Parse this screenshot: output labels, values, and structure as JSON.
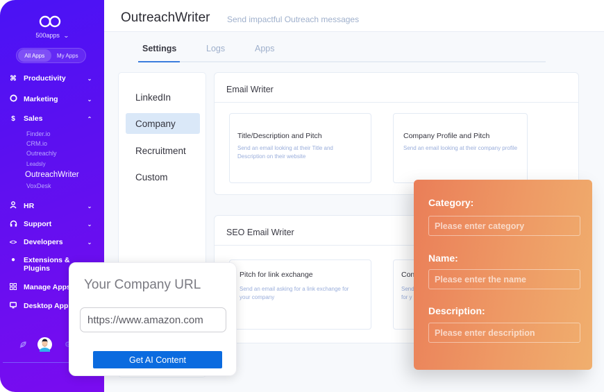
{
  "sidebar": {
    "brand": "500apps",
    "toggle": [
      {
        "label": "All Apps",
        "active": true
      },
      {
        "label": "My Apps",
        "active": false
      }
    ],
    "nav": [
      {
        "label": "Productivity",
        "icon": "command-icon",
        "expanded": false
      },
      {
        "label": "Marketing",
        "icon": "lifebuoy-icon",
        "expanded": false
      },
      {
        "label": "Sales",
        "icon": "dollar-icon",
        "expanded": true
      },
      {
        "label": "HR",
        "icon": "user-icon",
        "expanded": false
      },
      {
        "label": "Support",
        "icon": "headphones-icon",
        "expanded": false
      },
      {
        "label": "Developers",
        "icon": "code-icon",
        "expanded": false
      },
      {
        "label": "Extensions & Plugins",
        "icon": "puzzle-icon"
      },
      {
        "label": "Manage Apps",
        "icon": "grid-icon"
      },
      {
        "label": "Desktop Apps",
        "icon": "monitor-icon"
      }
    ],
    "sales_apps": [
      "Finder.io",
      "CRM.io",
      "Outreachly",
      "Leadsly",
      "OutreachWriter",
      "VoxDesk"
    ],
    "active_app": "OutreachWriter",
    "footer_icons": [
      "feather-icon",
      "avatar",
      "settings-icon"
    ]
  },
  "header": {
    "title": "OutreachWriter",
    "subtitle": "Send impactful Outreach messages"
  },
  "tabs": [
    {
      "label": "Settings",
      "active": true
    },
    {
      "label": "Logs",
      "active": false
    },
    {
      "label": "Apps",
      "active": false
    }
  ],
  "categories": [
    {
      "label": "LinkedIn",
      "active": false
    },
    {
      "label": "Company",
      "active": true
    },
    {
      "label": "Recruitment",
      "active": false
    },
    {
      "label": "Custom",
      "active": false
    }
  ],
  "sections": [
    {
      "title": "Email Writer",
      "cards": [
        {
          "title": "Title/Description and Pitch",
          "desc": "Send an email looking at their Title and Description on their website"
        },
        {
          "title": "Company Profile and Pitch",
          "desc": "Send an email looking at their company profile"
        }
      ]
    },
    {
      "title": "SEO Email Writer",
      "cards": [
        {
          "title": "Pitch for link exchange",
          "desc": "Send an email asking for a link exchange for your company"
        },
        {
          "title": "Con",
          "desc": "Send for y"
        }
      ]
    }
  ],
  "url_popup": {
    "title": "Your Company URL",
    "input_value": "https://www.amazon.com",
    "button": "Get AI Content"
  },
  "form": {
    "fields": [
      {
        "label": "Category:",
        "placeholder": "Please enter category"
      },
      {
        "label": "Name:",
        "placeholder": "Please enter the name"
      },
      {
        "label": "Description:",
        "placeholder": "Please enter description"
      }
    ]
  },
  "colors": {
    "sidebar_start": "#4a12f5",
    "sidebar_end": "#7a0cf0",
    "accent_blue": "#3b7ddd",
    "button_blue": "#0b6bdf",
    "form_orange_start": "#ea7e58",
    "form_orange_end": "#f0af6e"
  }
}
